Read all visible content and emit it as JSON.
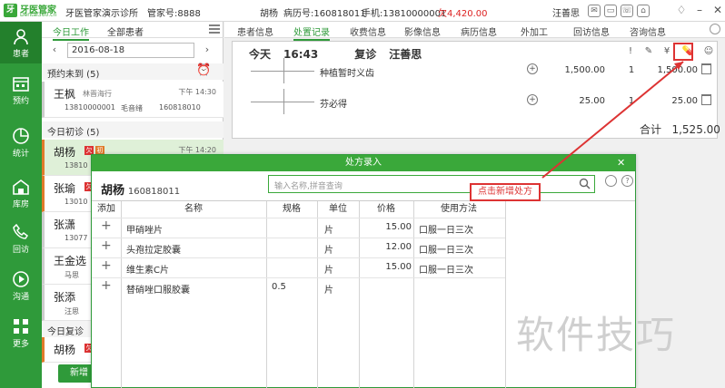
{
  "titlebar": {
    "logo_name": "牙医管家",
    "logo_domain": "Dental360.cn",
    "clinic": "牙医管家演示诊所",
    "account": "管家号:8888",
    "patient": "胡杨",
    "record_no": "病历号:160818011",
    "phone": "手机:13810000001",
    "debt": "欠4,420.00",
    "user": "汪善思"
  },
  "nav": {
    "items": [
      {
        "label": "患者",
        "icon": "user-icon"
      },
      {
        "label": "预约",
        "icon": "calendar-icon"
      },
      {
        "label": "统计",
        "icon": "pie-chart-icon"
      },
      {
        "label": "库房",
        "icon": "warehouse-icon"
      },
      {
        "label": "回访",
        "icon": "phone-icon"
      },
      {
        "label": "沟通",
        "icon": "play-icon"
      },
      {
        "label": "更多",
        "icon": "grid-icon"
      }
    ]
  },
  "list": {
    "tab_today": "今日工作",
    "tab_all": "全部患者",
    "date": "2016-08-18",
    "group_appt": "预约未到 (5)",
    "group_first": "今日初诊 (5)",
    "group_return": "今日复诊",
    "new_button": "新增",
    "patients": [
      {
        "name": "王枫",
        "doctor": "林晋海行",
        "time": "下午 14:30",
        "phone": "13810000001",
        "extra": "毛音绪",
        "record": "160818010"
      },
      {
        "name": "胡杨",
        "time": "下午 14:20",
        "phone": "13810",
        "badge1": "欠",
        "badge2": "初"
      },
      {
        "name": "张瑜",
        "phone": "13010",
        "badge1": "欠"
      },
      {
        "name": "张潇",
        "phone": "13077"
      },
      {
        "name": "王金选",
        "phone": "马思"
      },
      {
        "name": "张添",
        "phone": "汪思"
      },
      {
        "name": "胡杨",
        "badge1": "欠"
      }
    ]
  },
  "record_tabs": [
    "患者信息",
    "处置记录",
    "收费信息",
    "影像信息",
    "病历信息",
    "外加工",
    "回访信息",
    "咨询信息"
  ],
  "record": {
    "day": "今天",
    "time": "16:43",
    "visit_type": "复诊",
    "doctor": "汪善思",
    "items": [
      {
        "name": "种植暂时义齿",
        "price": "1,500.00",
        "qty": "1",
        "total": "1,500.00"
      },
      {
        "name": "芬必得",
        "price": "25.00",
        "qty": "1",
        "total": "25.00"
      }
    ],
    "sum_label": "合计",
    "sum_value": "1,525.00"
  },
  "dialog": {
    "title": "处方录入",
    "patient_name": "胡杨",
    "patient_no": "160818011",
    "search_placeholder": "输入名称,拼音查询",
    "columns": {
      "add": "添加",
      "name": "名称",
      "spec": "规格",
      "unit": "单位",
      "price": "价格",
      "usage": "使用方法"
    },
    "rows": [
      {
        "name": "甲硝唑片",
        "spec": "",
        "unit": "片",
        "price": "15.00",
        "usage": "口服一日三次"
      },
      {
        "name": "头孢拉定胶囊",
        "spec": "",
        "unit": "片",
        "price": "12.00",
        "usage": "口服一日三次"
      },
      {
        "name": "维生素C片",
        "spec": "",
        "unit": "片",
        "price": "15.00",
        "usage": "口服一日三次"
      },
      {
        "name": "替硝唑口服胶囊",
        "spec": "0.5",
        "unit": "片",
        "price": "",
        "usage": ""
      }
    ]
  },
  "annotation": {
    "text": "点击新增处方",
    "color": "#dd3333"
  },
  "watermark": "软件技巧",
  "colors": {
    "brand_green": "#2f9a3a",
    "alert_red": "#dd2222"
  }
}
